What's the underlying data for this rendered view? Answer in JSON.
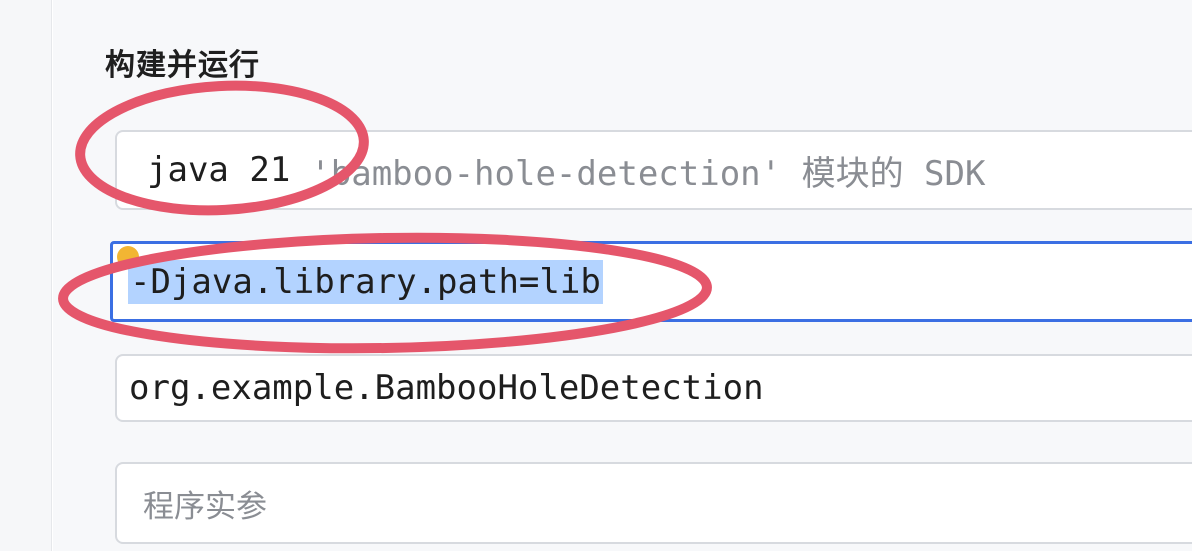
{
  "section": {
    "title": "构建并运行"
  },
  "jre": {
    "version": "java 21",
    "hint": "'bamboo-hole-detection' 模块的 SDK"
  },
  "vm_options": {
    "value": "-Djava.library.path=lib"
  },
  "main_class": {
    "value": "org.example.BambooHoleDetection"
  },
  "program_args": {
    "placeholder": "程序实参"
  },
  "colors": {
    "annotation": "#e5566b",
    "focus_border": "#3b6fe3",
    "selection": "#b3d3ff"
  }
}
